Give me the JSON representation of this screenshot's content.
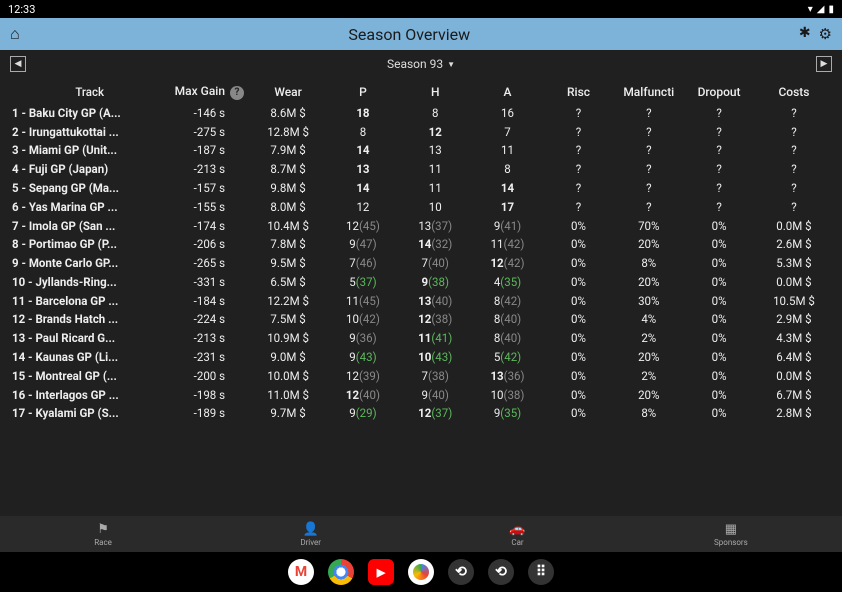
{
  "status": {
    "time": "12:33"
  },
  "header": {
    "title": "Season Overview"
  },
  "season": {
    "label": "Season 93"
  },
  "columns": {
    "track": "Track",
    "maxgain": "Max Gain",
    "wear": "Wear",
    "p": "P",
    "h": "H",
    "a": "A",
    "risc": "Risc",
    "malfuncti": "Malfuncti",
    "dropout": "Dropout",
    "costs": "Costs"
  },
  "rows": [
    {
      "track": "1 - Baku City GP (A...",
      "maxgain": "-146 s",
      "wear": "8.6M $",
      "p": "18",
      "p_b": true,
      "h": "8",
      "a": "16",
      "risc": "?",
      "mal": "?",
      "drop": "?",
      "costs": "?"
    },
    {
      "track": "2 - Irungattukottai ...",
      "maxgain": "-275 s",
      "wear": "12.8M $",
      "p": "8",
      "h": "12",
      "h_b": true,
      "a": "7",
      "risc": "?",
      "mal": "?",
      "drop": "?",
      "costs": "?"
    },
    {
      "track": "3 - Miami GP (Unit...",
      "maxgain": "-187 s",
      "wear": "7.9M $",
      "p": "14",
      "p_b": true,
      "h": "13",
      "a": "11",
      "risc": "?",
      "mal": "?",
      "drop": "?",
      "costs": "?"
    },
    {
      "track": "4 - Fuji GP (Japan)",
      "maxgain": "-213 s",
      "wear": "8.7M $",
      "p": "13",
      "p_b": true,
      "h": "11",
      "a": "8",
      "risc": "?",
      "mal": "?",
      "drop": "?",
      "costs": "?"
    },
    {
      "track": "5 - Sepang GP (Ma...",
      "maxgain": "-157 s",
      "wear": "9.8M $",
      "p": "14",
      "p_b": true,
      "h": "11",
      "a": "14",
      "a_b": true,
      "risc": "?",
      "mal": "?",
      "drop": "?",
      "costs": "?"
    },
    {
      "track": "6 - Yas Marina GP ...",
      "maxgain": "-155 s",
      "wear": "8.0M $",
      "p": "12",
      "h": "10",
      "a": "17",
      "a_b": true,
      "risc": "?",
      "mal": "?",
      "drop": "?",
      "costs": "?"
    },
    {
      "track": "7 - Imola GP (San ...",
      "maxgain": "-174 s",
      "wear": "10.4M $",
      "p": "12",
      "pp": "(45)",
      "h": "13",
      "hp": "(37)",
      "a": "9",
      "ap": "(41)",
      "risc": "0%",
      "mal": "70%",
      "drop": "0%",
      "costs": "0.0M $"
    },
    {
      "track": "8 - Portimao GP (P...",
      "maxgain": "-206 s",
      "wear": "7.8M $",
      "p": "9",
      "pp": "(47)",
      "h": "14",
      "h_b": true,
      "hp": "(32)",
      "a": "11",
      "ap": "(42)",
      "risc": "0%",
      "mal": "20%",
      "drop": "0%",
      "costs": "2.6M $"
    },
    {
      "track": "9 - Monte Carlo GP...",
      "maxgain": "-265 s",
      "wear": "9.5M $",
      "p": "7",
      "pp": "(46)",
      "h": "7",
      "hp": "(40)",
      "a": "12",
      "a_b": true,
      "ap": "(42)",
      "risc": "0%",
      "mal": "8%",
      "drop": "0%",
      "costs": "5.3M $"
    },
    {
      "track": "10 - Jyllands-Ring...",
      "maxgain": "-331 s",
      "wear": "6.5M $",
      "p": "5",
      "pp": "(37)",
      "ppc": "green",
      "h": "9",
      "h_b": true,
      "hp": "(38)",
      "hpc": "green",
      "a": "4",
      "ap": "(35)",
      "apc": "green",
      "risc": "0%",
      "mal": "20%",
      "drop": "0%",
      "costs": "0.0M $"
    },
    {
      "track": "11 - Barcelona GP ...",
      "maxgain": "-184 s",
      "wear": "12.2M $",
      "p": "11",
      "pp": "(45)",
      "h": "13",
      "h_b": true,
      "hp": "(40)",
      "a": "8",
      "ap": "(42)",
      "risc": "0%",
      "mal": "30%",
      "drop": "0%",
      "costs": "10.5M $"
    },
    {
      "track": "12 - Brands Hatch ...",
      "maxgain": "-224 s",
      "wear": "7.5M $",
      "p": "10",
      "pp": "(42)",
      "h": "12",
      "h_b": true,
      "hp": "(38)",
      "a": "8",
      "ap": "(40)",
      "risc": "0%",
      "mal": "4%",
      "drop": "0%",
      "costs": "2.9M $"
    },
    {
      "track": "13 - Paul Ricard G...",
      "maxgain": "-213 s",
      "wear": "10.9M $",
      "p": "9",
      "pp": "(36)",
      "h": "11",
      "h_b": true,
      "hp": "(41)",
      "hpc": "green",
      "a": "8",
      "ap": "(40)",
      "risc": "0%",
      "mal": "2%",
      "drop": "0%",
      "costs": "4.3M $"
    },
    {
      "track": "14 - Kaunas GP (Li...",
      "maxgain": "-231 s",
      "wear": "9.0M $",
      "p": "9",
      "pp": "(43)",
      "ppc": "green",
      "h": "10",
      "h_b": true,
      "hp": "(43)",
      "hpc": "green",
      "a": "5",
      "ap": "(42)",
      "apc": "green",
      "risc": "0%",
      "mal": "20%",
      "drop": "0%",
      "costs": "6.4M $"
    },
    {
      "track": "15 - Montreal GP (...",
      "maxgain": "-200 s",
      "wear": "10.0M $",
      "p": "12",
      "pp": "(39)",
      "h": "7",
      "hp": "(38)",
      "a": "13",
      "a_b": true,
      "ap": "(36)",
      "risc": "0%",
      "mal": "2%",
      "drop": "0%",
      "costs": "0.0M $"
    },
    {
      "track": "16 - Interlagos GP ...",
      "maxgain": "-198 s",
      "wear": "11.0M $",
      "p": "12",
      "p_b": true,
      "pp": "(40)",
      "h": "9",
      "hp": "(40)",
      "a": "10",
      "ap": "(38)",
      "risc": "0%",
      "mal": "20%",
      "drop": "0%",
      "costs": "6.7M $"
    },
    {
      "track": "17 - Kyalami GP (S...",
      "maxgain": "-189 s",
      "wear": "9.7M $",
      "p": "9",
      "pp": "(29)",
      "ppc": "green",
      "h": "12",
      "h_b": true,
      "hp": "(37)",
      "hpc": "green",
      "a": "9",
      "ap": "(35)",
      "apc": "green",
      "risc": "0%",
      "mal": "8%",
      "drop": "0%",
      "costs": "2.8M $"
    }
  ],
  "nav": {
    "race": "Race",
    "driver": "Driver",
    "car": "Car",
    "sponsors": "Sponsors"
  }
}
